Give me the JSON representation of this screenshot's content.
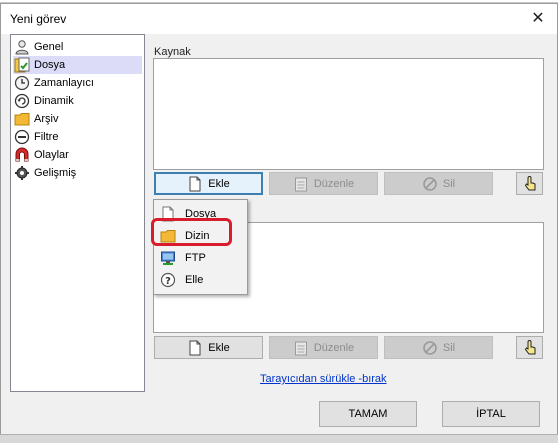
{
  "window": {
    "title": "Yeni görev",
    "close_glyph": "✕"
  },
  "sidebar": {
    "items": [
      {
        "label": "Genel",
        "icon": "user-icon"
      },
      {
        "label": "Dosya",
        "icon": "file-copy-icon",
        "selected": true
      },
      {
        "label": "Zamanlayıcı",
        "icon": "clock-icon"
      },
      {
        "label": "Dinamik",
        "icon": "refresh-icon"
      },
      {
        "label": "Arşiv",
        "icon": "folder-icon"
      },
      {
        "label": "Filtre",
        "icon": "filter-icon"
      },
      {
        "label": "Olaylar",
        "icon": "magnet-icon"
      },
      {
        "label": "Gelişmiş",
        "icon": "gear-icon"
      }
    ]
  },
  "source": {
    "label": "Kaynak",
    "buttons": {
      "add": "Ekle",
      "edit": "Düzenle",
      "delete": "Sil"
    }
  },
  "destination": {
    "buttons": {
      "add": "Ekle",
      "edit": "Düzenle",
      "delete": "Sil"
    },
    "drag_link": "Tarayıcıdan sürükle -bırak"
  },
  "context_menu": {
    "items": [
      {
        "label": "Dosya",
        "icon": "file-icon"
      },
      {
        "label": "Dizin",
        "icon": "folder-icon",
        "highlighted": true
      },
      {
        "label": "FTP",
        "icon": "ftp-icon"
      },
      {
        "label": "Elle",
        "icon": "help-icon"
      }
    ]
  },
  "footer": {
    "ok": "TAMAM",
    "cancel": "İPTAL"
  },
  "colors": {
    "selection": "#dcdcf8",
    "highlight_ring": "#d81c2c",
    "link": "#0033cc",
    "focus": "#3c7fb1"
  }
}
